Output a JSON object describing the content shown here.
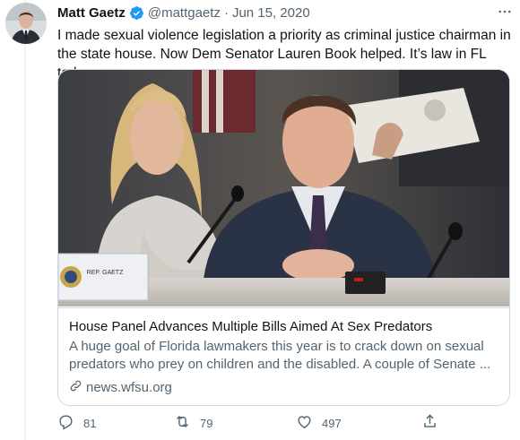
{
  "author": {
    "name": "Matt Gaetz",
    "handle": "@mattgaetz",
    "separator": "·",
    "date": "Jun 15, 2020"
  },
  "tweet": {
    "text": "I made sexual violence legislation a priority as criminal justice chairman in the state house. Now Dem Senator Lauren Book helped.  It’s law in FL today."
  },
  "card": {
    "title": "House Panel Advances Multiple Bills Aimed At Sex Predators",
    "description": "A huge goal of Florida lawmakers this year is to crack down on sexual predators who prey on children and the disabled. A couple of Senate ...",
    "domain": "news.wfsu.org",
    "nameplate_text": "REP. GAETZ"
  },
  "actions": {
    "replies": "81",
    "retweets": "79",
    "likes": "497"
  },
  "colors": {
    "verified": "#1d9bf0",
    "secondary_text": "#536471",
    "border": "#cfd9de"
  },
  "icons": [
    "verified-badge-icon",
    "more-icon",
    "link-icon",
    "reply-icon",
    "retweet-icon",
    "like-icon",
    "share-icon"
  ]
}
